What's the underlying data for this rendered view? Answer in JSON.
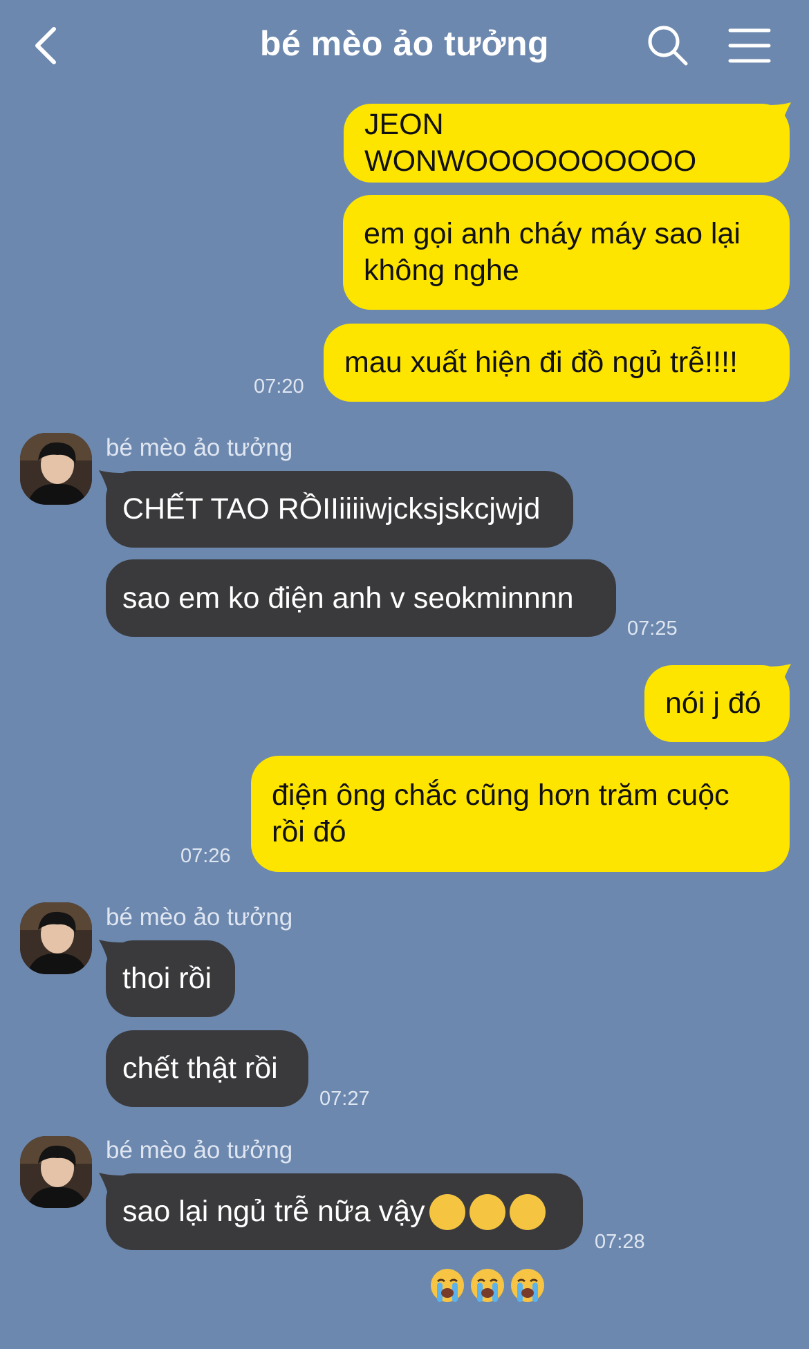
{
  "header": {
    "title": "bé mèo ảo tưởng",
    "back_icon": "chevron-left-icon",
    "search_icon": "search-icon",
    "menu_icon": "hamburger-menu-icon"
  },
  "colors": {
    "background": "#6d88ae",
    "my_bubble": "#fee500",
    "their_bubble": "#3a3a3c"
  },
  "messages": [
    {
      "from": "me",
      "text": "JEON WONWOOOOOOOOOO"
    },
    {
      "from": "me",
      "text": "em gọi anh cháy máy sao lại không nghe"
    },
    {
      "from": "me",
      "text": "mau xuất hiện đi đồ ngủ trễ!!!!",
      "time": "07:20"
    },
    {
      "from": "them",
      "sender": "bé mèo ảo tưởng",
      "text": "CHẾT TAO RỒIIiiiiwjcksjskcjwjd"
    },
    {
      "from": "them",
      "text": "sao em ko điện anh v seokminnnn",
      "time": "07:25"
    },
    {
      "from": "me",
      "text": "nói j đó"
    },
    {
      "from": "me",
      "text": "điện ông chắc cũng hơn trăm cuộc rồi đó",
      "time": "07:26"
    },
    {
      "from": "them",
      "sender": "bé mèo ảo tưởng",
      "text": "thoi rồi"
    },
    {
      "from": "them",
      "text": "chết thật rồi",
      "time": "07:27"
    },
    {
      "from": "them",
      "sender": "bé mèo ảo tưởng",
      "text": "sao lại ngủ trễ nữa vậy",
      "emoji": "loudly-crying-face-emoji",
      "time": "07:28"
    }
  ]
}
